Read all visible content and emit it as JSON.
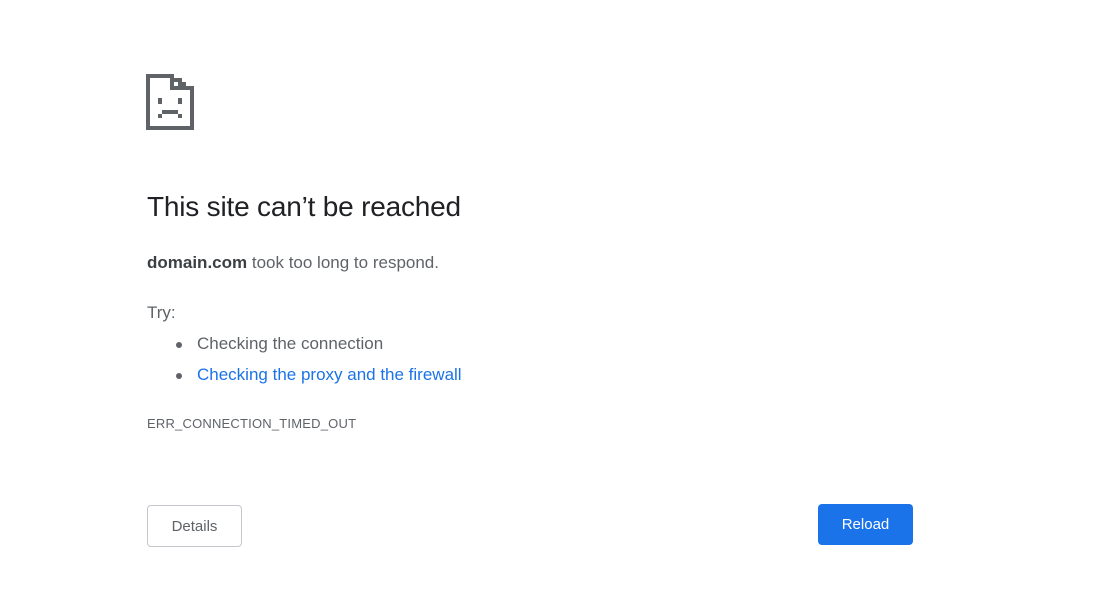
{
  "icon": {
    "name": "sad-page-icon"
  },
  "headline": "This site can’t be reached",
  "summary": {
    "domain": "domain.com",
    "message": " took too long to respond."
  },
  "try_label": "Try:",
  "suggestions": [
    {
      "text": "Checking the connection",
      "is_link": false
    },
    {
      "text": "Checking the proxy and the firewall",
      "is_link": true
    }
  ],
  "error_code": "ERR_CONNECTION_TIMED_OUT",
  "buttons": {
    "details": "Details",
    "reload": "Reload"
  },
  "colors": {
    "link": "#1a73e8",
    "primary_button": "#1a73e8",
    "headline": "#202124",
    "body_text": "#5f6368"
  }
}
